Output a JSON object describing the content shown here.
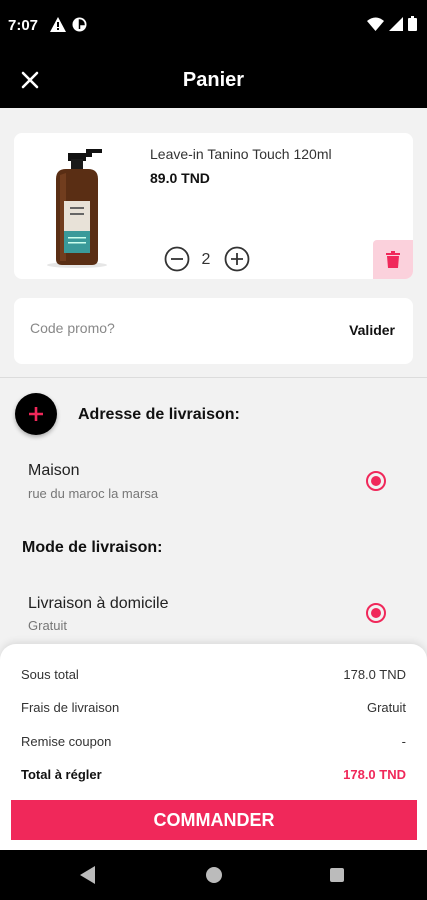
{
  "status_bar": {
    "time": "7:07",
    "icons": [
      "warning-icon",
      "data-saver-icon",
      "wifi-icon",
      "signal-icon",
      "battery-icon"
    ]
  },
  "app_bar": {
    "title": "Panier",
    "close_icon": "close-icon"
  },
  "cart": {
    "items": [
      {
        "name": "Leave-in Tanino Touch 120ml",
        "price": "89.0 TND",
        "quantity": "2",
        "image": "tanino-bottle-image"
      }
    ]
  },
  "promo": {
    "placeholder": "Code promo?",
    "validate_label": "Valider"
  },
  "delivery_address": {
    "title": "Adresse de livraison:",
    "options": [
      {
        "name": "Maison",
        "detail": "rue du maroc la marsa",
        "selected": true
      }
    ]
  },
  "delivery_mode": {
    "title": "Mode de livraison:",
    "options": [
      {
        "name": "Livraison à domicile",
        "detail": "Gratuit",
        "selected": true
      }
    ]
  },
  "summary": {
    "subtotal_label": "Sous total",
    "subtotal_value": "178.0 TND",
    "shipping_label": "Frais de livraison",
    "shipping_value": "Gratuit",
    "coupon_label": "Remise coupon",
    "coupon_value": "-",
    "total_label": "Total à régler",
    "total_value": "178.0 TND"
  },
  "order_button": {
    "label": "COMMANDER"
  },
  "colors": {
    "accent": "#f0285a",
    "accent_light": "#fbd1dc",
    "header": "#000000",
    "background": "#f2f2f2"
  }
}
